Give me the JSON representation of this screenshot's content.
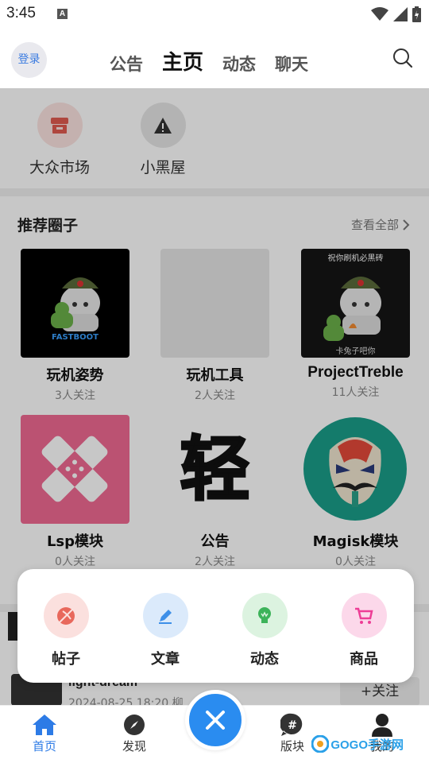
{
  "status_bar": {
    "time": "3:45",
    "a_badge": "A"
  },
  "top_nav": {
    "login": "登录",
    "tabs": [
      {
        "label": "公告"
      },
      {
        "label": "主页"
      },
      {
        "label": "动态"
      },
      {
        "label": "聊天"
      }
    ]
  },
  "quick_links": [
    {
      "label": "大众市场",
      "icon": "store-icon",
      "color": "#e07070"
    },
    {
      "label": "小黑屋",
      "icon": "warning-icon",
      "color": "#444444"
    }
  ],
  "recommended": {
    "title": "推荐圈子",
    "see_all": "查看全部",
    "circles": [
      {
        "name": "玩机姿势",
        "followers": "3人关注",
        "image_text": "FASTBOOT"
      },
      {
        "name": "玩机工具",
        "followers": "2人关注"
      },
      {
        "name": "ProjectTreble",
        "followers": "11人关注",
        "image_text_top": "祝你刷机必黑砖",
        "image_text_bottom": "卡兔子吧你"
      },
      {
        "name": "Lsp模块",
        "followers": "0人关注"
      },
      {
        "name": "公告",
        "followers": "2人关注",
        "image_text": "轻"
      },
      {
        "name": "Magisk模块",
        "followers": "0人关注"
      }
    ]
  },
  "feed_peek": {
    "user": "light-dream",
    "date": "2024-08-25 18:20 柳",
    "follow": "+关注"
  },
  "publish_sheet": {
    "items": [
      {
        "label": "帖子",
        "icon": "post-icon",
        "bg": "#fbe0de",
        "fg": "#e8685c"
      },
      {
        "label": "文章",
        "icon": "pencil-icon",
        "bg": "#dbeafb",
        "fg": "#3d8fe8"
      },
      {
        "label": "动态",
        "icon": "bulb-icon",
        "bg": "#dcf3e0",
        "fg": "#3db35a"
      },
      {
        "label": "商品",
        "icon": "cart-icon",
        "bg": "#fcd8ea",
        "fg": "#ee3d96"
      }
    ]
  },
  "bottom_nav": {
    "items": [
      {
        "label": "首页"
      },
      {
        "label": "发现"
      },
      {
        "label": "版块"
      },
      {
        "label": "我的"
      }
    ]
  },
  "watermark": "GOGO手游网"
}
